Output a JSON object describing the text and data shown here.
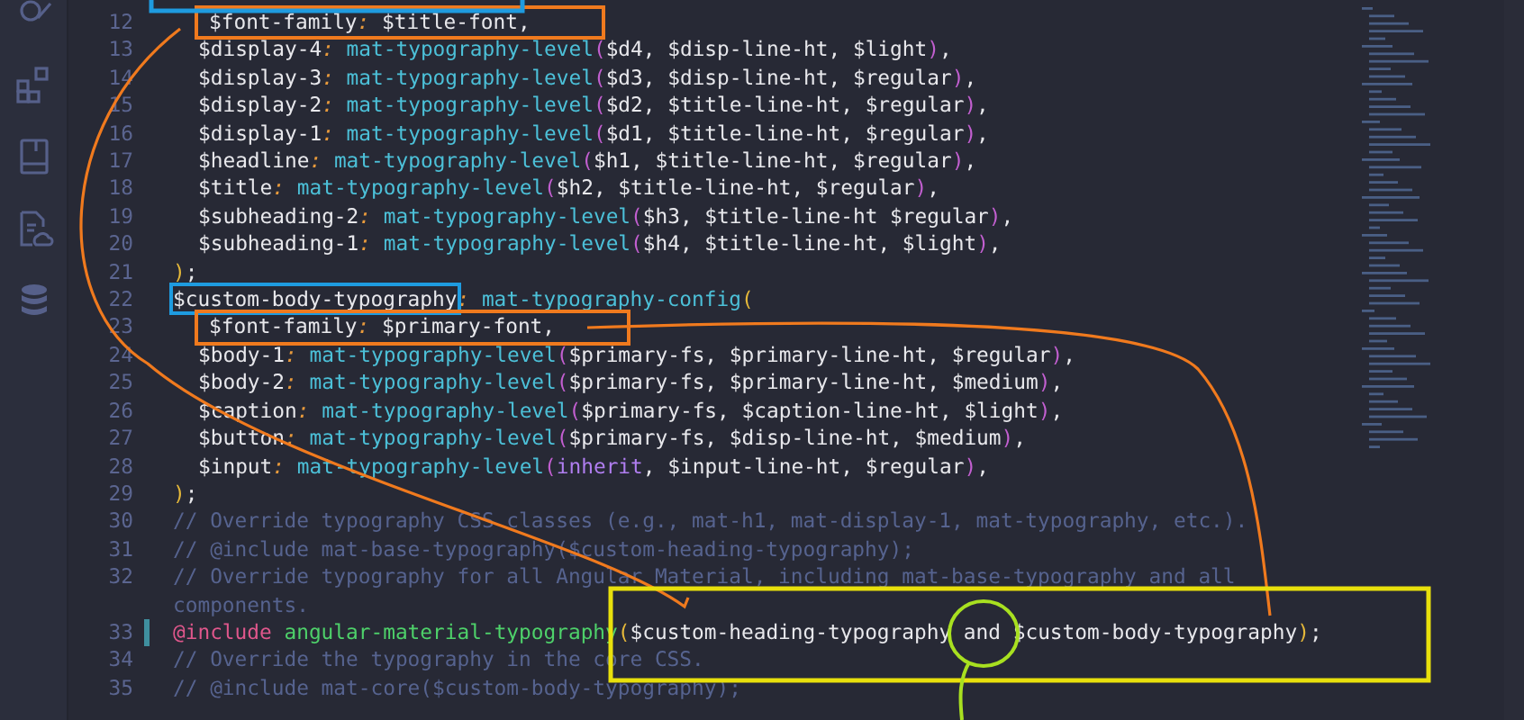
{
  "editor": {
    "lines": [
      {
        "number": "12",
        "indented": true,
        "modified": false,
        "color": "#f07a1e",
        "segments": [
          {
            "kind": "var",
            "text": "$font-family"
          },
          {
            "kind": "colon",
            "text": ":"
          },
          {
            "kind": "var",
            "text": " $title-font,"
          }
        ]
      },
      {
        "number": "13",
        "indented": true,
        "modified": false,
        "segments": [
          {
            "kind": "var",
            "text": "$display-4"
          },
          {
            "kind": "colon",
            "text": ":"
          },
          {
            "kind": "fn",
            "text": " mat-typography-level"
          },
          {
            "kind": "paren",
            "text": "("
          },
          {
            "kind": "var",
            "text": "$d4, $disp-line-ht, $light"
          },
          {
            "kind": "paren",
            "text": ")"
          },
          {
            "kind": "var",
            "text": ","
          }
        ]
      },
      {
        "number": "14",
        "indented": true,
        "modified": false,
        "segments": [
          {
            "kind": "var",
            "text": "$display-3"
          },
          {
            "kind": "colon",
            "text": ":"
          },
          {
            "kind": "fn",
            "text": " mat-typography-level"
          },
          {
            "kind": "paren",
            "text": "("
          },
          {
            "kind": "var",
            "text": "$d3, $disp-line-ht, $regular"
          },
          {
            "kind": "paren",
            "text": ")"
          },
          {
            "kind": "var",
            "text": ","
          }
        ]
      },
      {
        "number": "15",
        "indented": true,
        "modified": false,
        "segments": [
          {
            "kind": "var",
            "text": "$display-2"
          },
          {
            "kind": "colon",
            "text": ":"
          },
          {
            "kind": "fn",
            "text": " mat-typography-level"
          },
          {
            "kind": "paren",
            "text": "("
          },
          {
            "kind": "var",
            "text": "$d2, $title-line-ht, $regular"
          },
          {
            "kind": "paren",
            "text": ")"
          },
          {
            "kind": "var",
            "text": ","
          }
        ]
      },
      {
        "number": "16",
        "indented": true,
        "modified": false,
        "segments": [
          {
            "kind": "var",
            "text": "$display-1"
          },
          {
            "kind": "colon",
            "text": ":"
          },
          {
            "kind": "fn",
            "text": " mat-typography-level"
          },
          {
            "kind": "paren",
            "text": "("
          },
          {
            "kind": "var",
            "text": "$d1, $title-line-ht, $regular"
          },
          {
            "kind": "paren",
            "text": ")"
          },
          {
            "kind": "var",
            "text": ","
          }
        ]
      },
      {
        "number": "17",
        "indented": true,
        "modified": false,
        "segments": [
          {
            "kind": "var",
            "text": "$headline"
          },
          {
            "kind": "colon",
            "text": ":"
          },
          {
            "kind": "fn",
            "text": " mat-typography-level"
          },
          {
            "kind": "paren",
            "text": "("
          },
          {
            "kind": "var",
            "text": "$h1, $title-line-ht, $regular"
          },
          {
            "kind": "paren",
            "text": ")"
          },
          {
            "kind": "var",
            "text": ","
          }
        ]
      },
      {
        "number": "18",
        "indented": true,
        "modified": false,
        "segments": [
          {
            "kind": "var",
            "text": "$title"
          },
          {
            "kind": "colon",
            "text": ":"
          },
          {
            "kind": "fn",
            "text": " mat-typography-level"
          },
          {
            "kind": "paren",
            "text": "("
          },
          {
            "kind": "var",
            "text": "$h2, $title-line-ht, $regular"
          },
          {
            "kind": "paren",
            "text": ")"
          },
          {
            "kind": "var",
            "text": ","
          }
        ]
      },
      {
        "number": "19",
        "indented": true,
        "modified": false,
        "segments": [
          {
            "kind": "var",
            "text": "$subheading-2"
          },
          {
            "kind": "colon",
            "text": ":"
          },
          {
            "kind": "fn",
            "text": " mat-typography-level"
          },
          {
            "kind": "paren",
            "text": "("
          },
          {
            "kind": "var",
            "text": "$h3, $title-line-ht $regular"
          },
          {
            "kind": "paren",
            "text": ")"
          },
          {
            "kind": "var",
            "text": ","
          }
        ]
      },
      {
        "number": "20",
        "indented": true,
        "modified": false,
        "segments": [
          {
            "kind": "var",
            "text": "$subheading-1"
          },
          {
            "kind": "colon",
            "text": ":"
          },
          {
            "kind": "fn",
            "text": " mat-typography-level"
          },
          {
            "kind": "paren",
            "text": "("
          },
          {
            "kind": "var",
            "text": "$h4, $title-line-ht, $light"
          },
          {
            "kind": "paren",
            "text": ")"
          },
          {
            "kind": "var",
            "text": ","
          }
        ]
      },
      {
        "number": "21",
        "indented": false,
        "modified": false,
        "segments": [
          {
            "kind": "brace",
            "text": ")"
          },
          {
            "kind": "var",
            "text": ";"
          }
        ]
      },
      {
        "number": "22",
        "indented": false,
        "modified": false,
        "segments": [
          {
            "kind": "var",
            "text": "$custom-body-typography",
            "color": "#1e9be0"
          },
          {
            "kind": "colon",
            "text": ":"
          },
          {
            "kind": "fn",
            "text": " mat-typography-config"
          },
          {
            "kind": "brace",
            "text": "("
          }
        ]
      },
      {
        "number": "23",
        "indented": true,
        "modified": false,
        "color": "#f07a1e",
        "segments": [
          {
            "kind": "var",
            "text": "$font-family"
          },
          {
            "kind": "colon",
            "text": ":"
          },
          {
            "kind": "var",
            "text": " $primary-font,"
          }
        ]
      },
      {
        "number": "24",
        "indented": true,
        "modified": false,
        "segments": [
          {
            "kind": "var",
            "text": "$body-1"
          },
          {
            "kind": "colon",
            "text": ":"
          },
          {
            "kind": "fn",
            "text": " mat-typography-level"
          },
          {
            "kind": "paren",
            "text": "("
          },
          {
            "kind": "var",
            "text": "$primary-fs, $primary-line-ht, $regular"
          },
          {
            "kind": "paren",
            "text": ")"
          },
          {
            "kind": "var",
            "text": ","
          }
        ]
      },
      {
        "number": "25",
        "indented": true,
        "modified": false,
        "segments": [
          {
            "kind": "var",
            "text": "$body-2"
          },
          {
            "kind": "colon",
            "text": ":"
          },
          {
            "kind": "fn",
            "text": " mat-typography-level"
          },
          {
            "kind": "paren",
            "text": "("
          },
          {
            "kind": "var",
            "text": "$primary-fs, $primary-line-ht, $medium"
          },
          {
            "kind": "paren",
            "text": ")"
          },
          {
            "kind": "var",
            "text": ","
          }
        ]
      },
      {
        "number": "26",
        "indented": true,
        "modified": false,
        "segments": [
          {
            "kind": "var",
            "text": "$caption"
          },
          {
            "kind": "colon",
            "text": ":"
          },
          {
            "kind": "fn",
            "text": " mat-typography-level"
          },
          {
            "kind": "paren",
            "text": "("
          },
          {
            "kind": "var",
            "text": "$primary-fs, $caption-line-ht, $light"
          },
          {
            "kind": "paren",
            "text": ")"
          },
          {
            "kind": "var",
            "text": ","
          }
        ]
      },
      {
        "number": "27",
        "indented": true,
        "modified": false,
        "segments": [
          {
            "kind": "var",
            "text": "$button"
          },
          {
            "kind": "colon",
            "text": ":"
          },
          {
            "kind": "fn",
            "text": " mat-typography-level"
          },
          {
            "kind": "paren",
            "text": "("
          },
          {
            "kind": "var",
            "text": "$primary-fs, $disp-line-ht, $medium"
          },
          {
            "kind": "paren",
            "text": ")"
          },
          {
            "kind": "var",
            "text": ","
          }
        ]
      },
      {
        "number": "28",
        "indented": true,
        "modified": false,
        "segments": [
          {
            "kind": "var",
            "text": "$input"
          },
          {
            "kind": "colon",
            "text": ":"
          },
          {
            "kind": "fn",
            "text": " mat-typography-level"
          },
          {
            "kind": "paren",
            "text": "("
          },
          {
            "kind": "const",
            "text": "inherit"
          },
          {
            "kind": "var",
            "text": ", $input-line-ht, $regular"
          },
          {
            "kind": "paren",
            "text": ")"
          },
          {
            "kind": "var",
            "text": ","
          }
        ]
      },
      {
        "number": "29",
        "indented": false,
        "modified": false,
        "segments": [
          {
            "kind": "brace",
            "text": ")"
          },
          {
            "kind": "var",
            "text": ";"
          }
        ]
      },
      {
        "number": "30",
        "indented": false,
        "modified": false,
        "segments": [
          {
            "kind": "comment",
            "text": "// Override typography CSS classes (e.g., mat-h1, mat-display-1, mat-typography, etc.)."
          }
        ]
      },
      {
        "number": "31",
        "indented": false,
        "modified": false,
        "segments": [
          {
            "kind": "comment",
            "text": "// @include mat-base-typography($custom-heading-typography);"
          }
        ]
      },
      {
        "number": "32",
        "indented": false,
        "modified": false,
        "segments": [
          {
            "kind": "comment",
            "text": "// Override typography for all Angular Material, including mat-base-typography and all components."
          }
        ]
      },
      {
        "number": "33",
        "indented": false,
        "modified": true,
        "segments": [
          {
            "kind": "keyword",
            "text": "@include"
          },
          {
            "kind": "fn2",
            "text": " angular-material-typography"
          },
          {
            "kind": "brace",
            "text": "("
          },
          {
            "kind": "var",
            "text": "$custom-heading-typography and $custom-body-typography"
          },
          {
            "kind": "brace",
            "text": ")"
          },
          {
            "kind": "var",
            "text": ";"
          }
        ]
      },
      {
        "number": "34",
        "indented": false,
        "modified": false,
        "segments": [
          {
            "kind": "comment",
            "text": "// Override the typography in the core CSS."
          }
        ]
      },
      {
        "number": "35",
        "indented": false,
        "modified": false,
        "segments": [
          {
            "kind": "comment",
            "text": "// @include mat-core($custom-body-typography);"
          }
        ]
      }
    ]
  }
}
